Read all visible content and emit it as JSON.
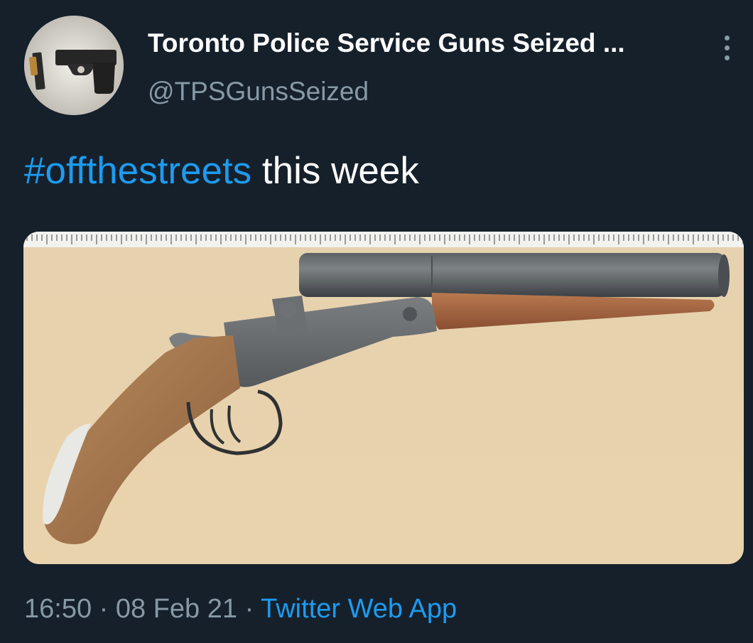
{
  "profile": {
    "display_name": "Toronto Police Service Guns Seized ...",
    "handle": "@TPSGunsSeized",
    "avatar_icon": "pistol-photo-avatar"
  },
  "more_icon": "vertical-ellipsis-icon",
  "tweet": {
    "hashtag": "#offthestreets",
    "text": " this week"
  },
  "media": {
    "subject": "sawed-off-double-barrel-shotgun-photo"
  },
  "meta": {
    "time": "16:50",
    "separator": " · ",
    "date": "08 Feb 21",
    "source": "Twitter Web App"
  },
  "colors": {
    "background": "#15202b",
    "text": "#ffffff",
    "secondary": "#8899a6",
    "accent": "#1d9bf0"
  }
}
